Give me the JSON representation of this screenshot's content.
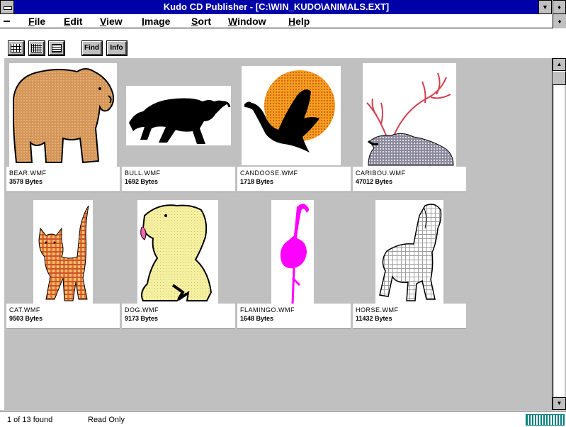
{
  "window": {
    "title": "Kudo CD Publisher - [C:\\WIN_KUDO\\ANIMALS.EXT]",
    "minimize_glyph": "▼",
    "maximize_glyph": "♦"
  },
  "menu": {
    "items": [
      {
        "underline": "F",
        "rest": "ile"
      },
      {
        "underline": "E",
        "rest": "dit"
      },
      {
        "underline": "V",
        "rest": "iew"
      },
      {
        "underline": "I",
        "rest": "mage"
      },
      {
        "underline": "S",
        "rest": "ort"
      },
      {
        "underline": "W",
        "rest": "indow"
      },
      {
        "underline": "H",
        "rest": "elp"
      }
    ],
    "restore_glyph": "♦"
  },
  "toolbar": {
    "find_label": "Find",
    "info_label": "Info",
    "icons": [
      "large-grid-icon",
      "small-grid-icon",
      "list-icon"
    ]
  },
  "thumbnails": [
    {
      "name": "BEAR.WMF",
      "size": "3578 Bytes",
      "icon": "bear-icon"
    },
    {
      "name": "BULL.WMF",
      "size": "1692 Bytes",
      "icon": "bull-icon"
    },
    {
      "name": "CANDOOSE.WMF",
      "size": "1718 Bytes",
      "icon": "goose-icon"
    },
    {
      "name": "CARIBOU.WMF",
      "size": "47012 Bytes",
      "icon": "caribou-icon"
    },
    {
      "name": "CAT.WMF",
      "size": "9503 Bytes",
      "icon": "cat-icon"
    },
    {
      "name": "DOG.WMF",
      "size": "9173 Bytes",
      "icon": "dog-icon"
    },
    {
      "name": "FLAMINGO.WMF",
      "size": "1648 Bytes",
      "icon": "flamingo-icon"
    },
    {
      "name": "HORSE.WMF",
      "size": "11432 Bytes",
      "icon": "horse-icon"
    }
  ],
  "status": {
    "count": "1 of 13 found",
    "mode": "Read Only"
  },
  "colors": {
    "title_bar": "#0000a8",
    "workspace": "#c0c0c0",
    "bear": "#d2955a",
    "goose_sun": "#f0a020",
    "flamingo": "#ff00ff",
    "dog": "#f5f0a0",
    "cat": "#e07a30",
    "meter": "#008080"
  }
}
